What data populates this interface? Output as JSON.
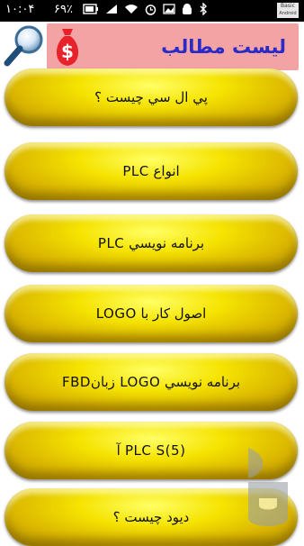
{
  "status_bar": {
    "time": "۱۰:۰۴",
    "battery": "۶۹٪",
    "corner_badge": {
      "line1": "Basic",
      "line2": "Android"
    }
  },
  "header": {
    "title": "لیست مطالب",
    "title_color": "#2a2ac8",
    "background": "#f3a3a3",
    "search_icon": "magnifier-icon",
    "money_icon": "money-bag-icon"
  },
  "items": [
    {
      "label": "پي ال سي چيست ؟"
    },
    {
      "label": "انواع  PLC"
    },
    {
      "label": "برنامه نويسي  PLC"
    },
    {
      "label": "اصول کار با LOGO"
    },
    {
      "label": "برنامه نويسي LOGO زبانFBD"
    },
    {
      "label": "PLC S(5) آ"
    },
    {
      "label": "ديود چيست ؟"
    }
  ],
  "accent_color": "#f5e300"
}
